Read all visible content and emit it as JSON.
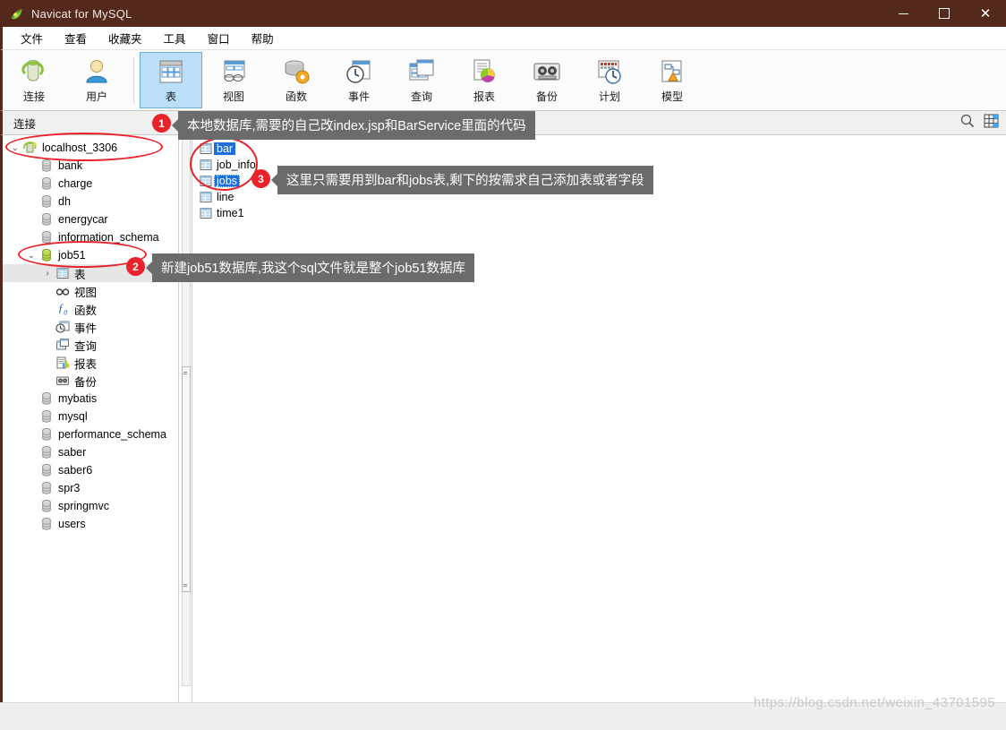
{
  "window": {
    "title": "Navicat for MySQL",
    "app_icon": "navicat-leaf-icon",
    "controls": {
      "minimize": "—",
      "maximize": "☐",
      "close": "✕"
    },
    "titlebar_color": "#54291b"
  },
  "menubar": {
    "items": [
      {
        "label": "文件",
        "name": "menu-file"
      },
      {
        "label": "查看",
        "name": "menu-view"
      },
      {
        "label": "收藏夹",
        "name": "menu-favorites"
      },
      {
        "label": "工具",
        "name": "menu-tools"
      },
      {
        "label": "窗口",
        "name": "menu-window"
      },
      {
        "label": "帮助",
        "name": "menu-help"
      }
    ]
  },
  "toolbar": {
    "group1": [
      {
        "label": "连接",
        "icon": "connection-icon",
        "name": "toolbar-connection",
        "active": false
      },
      {
        "label": "用户",
        "icon": "user-icon",
        "name": "toolbar-user",
        "active": false
      }
    ],
    "group2": [
      {
        "label": "表",
        "icon": "table-icon",
        "name": "toolbar-table",
        "active": true
      },
      {
        "label": "视图",
        "icon": "view-icon",
        "name": "toolbar-view",
        "active": false
      },
      {
        "label": "函数",
        "icon": "function-icon",
        "name": "toolbar-function",
        "active": false
      },
      {
        "label": "事件",
        "icon": "event-icon",
        "name": "toolbar-event",
        "active": false
      },
      {
        "label": "查询",
        "icon": "query-icon",
        "name": "toolbar-query",
        "active": false
      },
      {
        "label": "报表",
        "icon": "report-icon",
        "name": "toolbar-report",
        "active": false
      },
      {
        "label": "备份",
        "icon": "backup-icon",
        "name": "toolbar-backup",
        "active": false
      },
      {
        "label": "计划",
        "icon": "schedule-icon",
        "name": "toolbar-schedule",
        "active": false
      },
      {
        "label": "模型",
        "icon": "model-icon",
        "name": "toolbar-model",
        "active": false
      }
    ]
  },
  "connbar": {
    "label": "连接",
    "search_icon": "search-icon",
    "grid_icon": "grid-view-icon"
  },
  "tree": [
    {
      "label": "localhost_3306",
      "icon": "server-connection-icon",
      "indent": 0,
      "twist": "expanded",
      "selected": false
    },
    {
      "label": "bank",
      "icon": "database-icon",
      "indent": 1,
      "twist": "none",
      "selected": false
    },
    {
      "label": "charge",
      "icon": "database-icon",
      "indent": 1,
      "twist": "none",
      "selected": false
    },
    {
      "label": "dh",
      "icon": "database-icon",
      "indent": 1,
      "twist": "none",
      "selected": false
    },
    {
      "label": "energycar",
      "icon": "database-icon",
      "indent": 1,
      "twist": "none",
      "selected": false
    },
    {
      "label": "information_schema",
      "icon": "database-icon",
      "indent": 1,
      "twist": "none",
      "selected": false
    },
    {
      "label": "job51",
      "icon": "database-open-icon",
      "indent": 1,
      "twist": "expanded",
      "selected": false
    },
    {
      "label": "表",
      "icon": "table-icon",
      "indent": 2,
      "twist": "collapsed",
      "selected": true
    },
    {
      "label": "视图",
      "icon": "view-glasses-icon",
      "indent": 2,
      "twist": "none",
      "selected": false
    },
    {
      "label": "函数",
      "icon": "fn-icon",
      "indent": 2,
      "twist": "none",
      "selected": false
    },
    {
      "label": "事件",
      "icon": "event-clock-icon",
      "indent": 2,
      "twist": "none",
      "selected": false
    },
    {
      "label": "查询",
      "icon": "query-icon",
      "indent": 2,
      "twist": "none",
      "selected": false
    },
    {
      "label": "报表",
      "icon": "report-icon",
      "indent": 2,
      "twist": "none",
      "selected": false
    },
    {
      "label": "备份",
      "icon": "backup-tape-icon",
      "indent": 2,
      "twist": "none",
      "selected": false
    },
    {
      "label": "mybatis",
      "icon": "database-icon",
      "indent": 1,
      "twist": "none",
      "selected": false
    },
    {
      "label": "mysql",
      "icon": "database-icon",
      "indent": 1,
      "twist": "none",
      "selected": false
    },
    {
      "label": "performance_schema",
      "icon": "database-icon",
      "indent": 1,
      "twist": "none",
      "selected": false
    },
    {
      "label": "saber",
      "icon": "database-icon",
      "indent": 1,
      "twist": "none",
      "selected": false
    },
    {
      "label": "saber6",
      "icon": "database-icon",
      "indent": 1,
      "twist": "none",
      "selected": false
    },
    {
      "label": "spr3",
      "icon": "database-icon",
      "indent": 1,
      "twist": "none",
      "selected": false
    },
    {
      "label": "springmvc",
      "icon": "database-icon",
      "indent": 1,
      "twist": "none",
      "selected": false
    },
    {
      "label": "users",
      "icon": "database-icon",
      "indent": 1,
      "twist": "none",
      "selected": false
    }
  ],
  "table_list": [
    {
      "label": "bar",
      "icon": "table-icon",
      "state": "selected"
    },
    {
      "label": "job_info",
      "icon": "table-icon",
      "state": "normal"
    },
    {
      "label": "jobs",
      "icon": "table-icon",
      "state": "focused"
    },
    {
      "label": "line",
      "icon": "table-icon",
      "state": "normal"
    },
    {
      "label": "time1",
      "icon": "table-icon",
      "state": "normal"
    }
  ],
  "annotations": {
    "accent_color": "#e8232a",
    "callouts": [
      {
        "number": "1",
        "text": "本地数据库,需要的自己改index.jsp和BarService里面的代码"
      },
      {
        "number": "2",
        "text": "新建job51数据库,我这个sql文件就是整个job51数据库"
      },
      {
        "number": "3",
        "text": "这里只需要用到bar和jobs表,剩下的按需求自己添加表或者字段"
      }
    ]
  },
  "watermark": "https://blog.csdn.net/weixin_43701595"
}
